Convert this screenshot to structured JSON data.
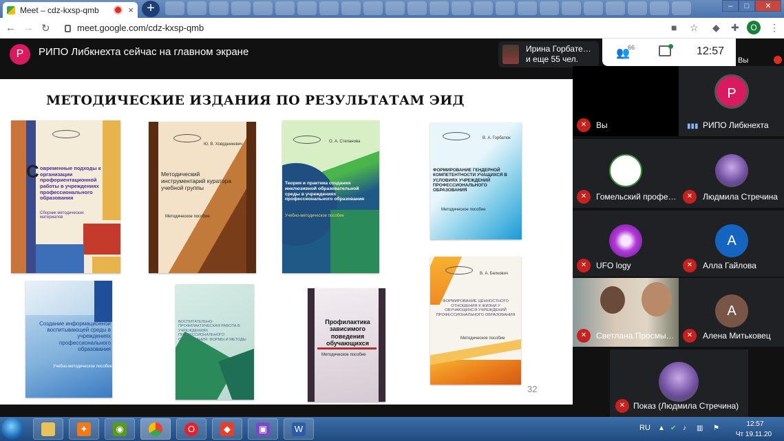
{
  "browser": {
    "tab_title": "Meet – cdz-kxsp-qmb",
    "tab_close": "×",
    "new_tab": "+",
    "window_controls": [
      "–",
      "□",
      "✕"
    ],
    "back": "←",
    "forward": "→",
    "reload": "↻",
    "url": "meet.google.com/cdz-kxsp-qmb",
    "profile_initial": "O"
  },
  "meet": {
    "presenter_initial": "P",
    "presenting_text": "РИПО Либкнехта сейчас на главном экране",
    "speaker_name": "Ирина Горбате…",
    "speaker_more": "и еще 55 чел.",
    "people_count": "66",
    "clock": "12:57",
    "self_label": "Вы"
  },
  "slide": {
    "title": "МЕТОДИЧЕСКИЕ ИЗДАНИЯ ПО РЕЗУЛЬТАТАМ ЭИД",
    "page_number": "32",
    "books": [
      {
        "title": "овременные подходы к организации профориентационной работы в учреждениях профессионального образования",
        "drop_cap": "С",
        "subtitle": "Сборник методических материалов"
      },
      {
        "title": "Методический инструментарий куратора учебной группы",
        "subtitle": "Методическое пособие",
        "author": "Ю. В. Ховрдникевич"
      },
      {
        "title": "Теория и практика создания инклюзивной образовательной среды в учреждениях профессионального образования",
        "subtitle": "Учебно-методическое пособие",
        "author": "О. А. Степанова"
      },
      {
        "title": "ФОРМИРОВАНИЕ ГЕНДЕРНОЙ КОМПЕТЕНТНОСТИ УЧАЩИХСЯ В УСЛОВИЯХ УЧРЕЖДЕНИЙ ПРОФЕССИОНАЛЬНОГО ОБРАЗОВАНИЯ",
        "subtitle": "Методическое пособие",
        "author": "В. А. Горбатюк"
      },
      {
        "title": "Создание информационной воспитывающей среды в учреждениях профессионального образования",
        "subtitle": "Учебно-методическое пособие"
      },
      {
        "title": "ВОСПИТАТЕЛЬНО-ПРОФИЛАКТИЧЕСКАЯ РАБОТА В УЧРЕЖДЕНИЯХ ПРОФЕССИОНАЛЬНОГО ОБРАЗОВАНИЯ: ФОРМЫ И МЕТОДЫ"
      },
      {
        "title": "Профилактика зависимого поведения обучающихся",
        "subtitle": "Методическое пособие"
      },
      {
        "title": "ФОРМИРОВАНИЕ ЦЕННОСТНОГО ОТНОШЕНИЯ К ЖИЗНИ У ОБУЧАЮЩИХСЯ УЧРЕЖДЕНИЙ ПРОФЕССИОНАЛЬНОГО ОБРАЗОВАНИЯ",
        "subtitle": "Методическое пособие",
        "author": "В. А. Белкович"
      }
    ]
  },
  "participants": [
    {
      "name": "Вы",
      "initial": "",
      "color": "#2b2b2b"
    },
    {
      "name": "РИПО Либкнехта",
      "initial": "P",
      "color": "#d81b60"
    },
    {
      "name": "Гомельский профе…",
      "initial": "",
      "color": "#ffffff"
    },
    {
      "name": "Людмила Стречина",
      "initial": "",
      "color": "#8a6fb8"
    },
    {
      "name": "UFO logy",
      "initial": "",
      "color": "#7a2fb8"
    },
    {
      "name": "Алла Гайлова",
      "initial": "A",
      "color": "#1565c0"
    },
    {
      "name": "Светлана Просмы…",
      "initial": "",
      "color": "#b8a99a"
    },
    {
      "name": "Алена Митьковец",
      "initial": "A",
      "color": "#795548"
    },
    {
      "name": "Показ (Людмила Стречина)",
      "initial": "",
      "color": "#8a6fb8"
    }
  ],
  "taskbar": {
    "language": "RU",
    "time": "12:57",
    "date": "Чт 19.11.20",
    "apps": [
      "explorer",
      "avast",
      "nvidia",
      "chrome",
      "opera",
      "anydesk",
      "save",
      "word"
    ]
  },
  "colors": {
    "meet_bg": "#111111",
    "tile_bg": "#202124",
    "mic_off": "#c5221f",
    "taskbar": "#2b5a94"
  }
}
